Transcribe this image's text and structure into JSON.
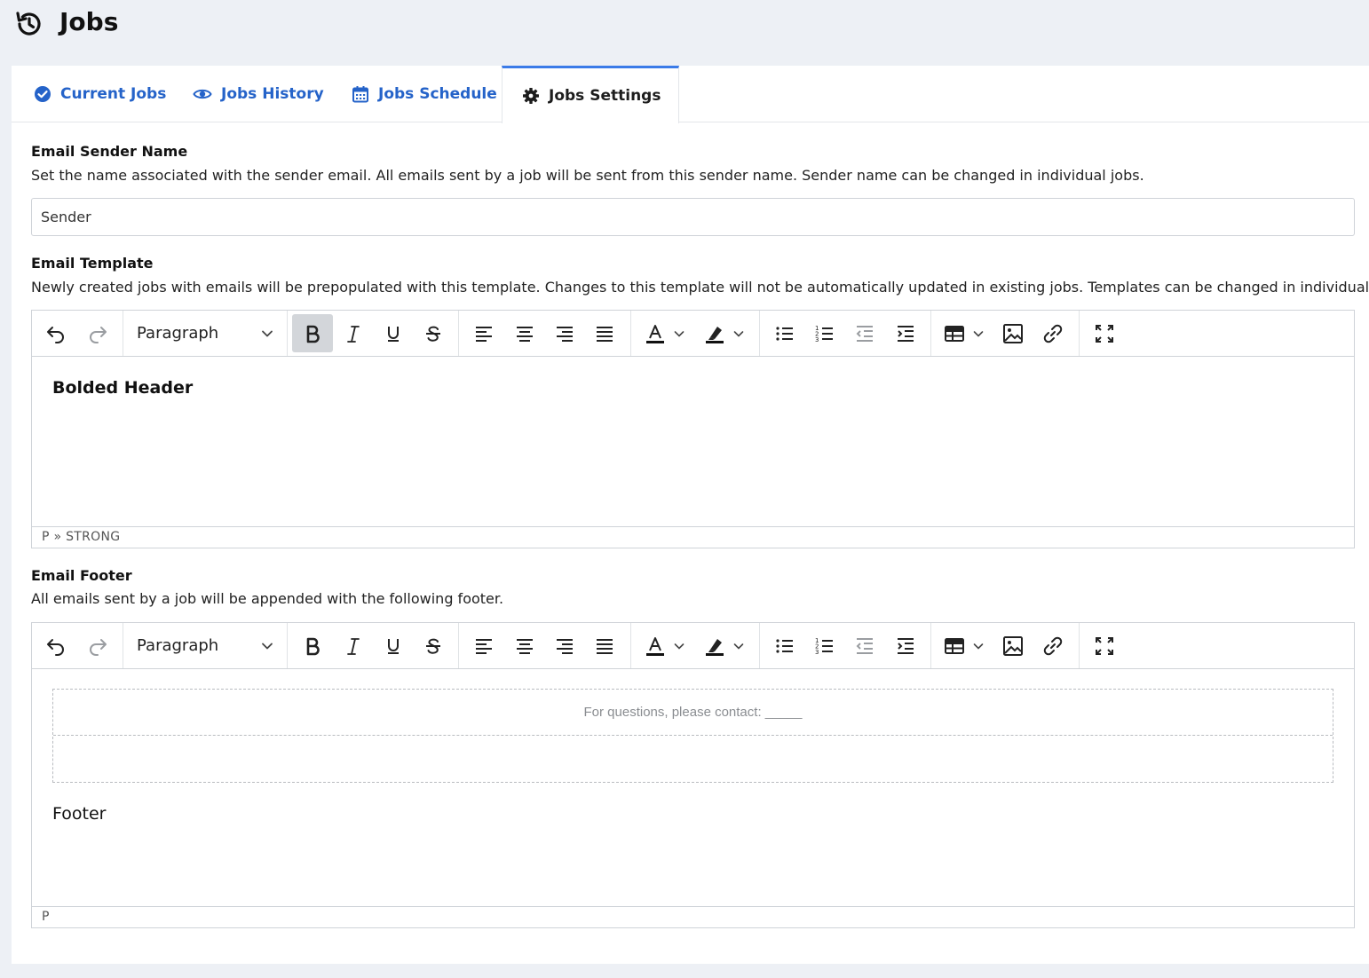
{
  "header": {
    "title": "Jobs",
    "icon": "history-icon"
  },
  "tabs": [
    {
      "label": "Current Jobs",
      "icon": "check-circle-icon",
      "active": false
    },
    {
      "label": "Jobs History",
      "icon": "eye-icon",
      "active": false
    },
    {
      "label": "Jobs Schedule",
      "icon": "calendar-icon",
      "active": false
    },
    {
      "label": "Jobs Settings",
      "icon": "gear-icon",
      "active": true
    }
  ],
  "sender": {
    "title": "Email Sender Name",
    "description": "Set the name associated with the sender email. All emails sent by a job will be sent from this sender name. Sender name can be changed in individual jobs.",
    "value": "Sender"
  },
  "template": {
    "title": "Email Template",
    "description": "Newly created jobs with emails will be prepopulated with this template. Changes to this template will not be automatically updated in existing jobs. Templates can be changed in individual jobs.",
    "format": "Paragraph",
    "content": "Bolded Header",
    "path": "P » STRONG"
  },
  "footer": {
    "title": "Email Footer",
    "description": "All emails sent by a job will be appended with the following footer.",
    "format": "Paragraph",
    "table_text": "For questions, please contact: _____",
    "content": "Footer",
    "path": "P"
  },
  "colors": {
    "accent": "#2563c9",
    "active_tab_border": "#3b7be8",
    "page_bg": "#edf0f5"
  }
}
